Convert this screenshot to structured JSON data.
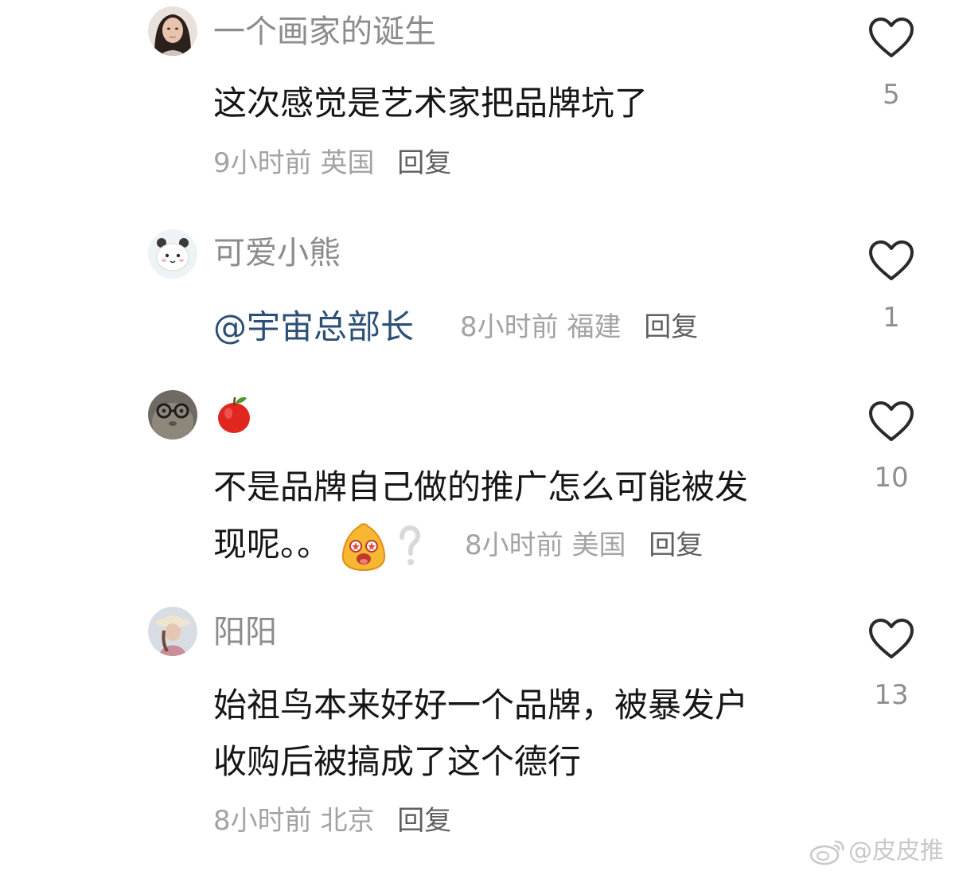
{
  "comments": [
    {
      "username": "一个画家的诞生",
      "text_lines": [
        "这次感觉是艺术家把品牌坑了"
      ],
      "time": "9小时前",
      "location": "英国",
      "reply_label": "回复",
      "likes": "5"
    },
    {
      "username": "可爱小熊",
      "mention": "@宇宙总部长",
      "time": "8小时前",
      "location": "福建",
      "reply_label": "回复",
      "likes": "1"
    },
    {
      "username": "🍎",
      "text_lines": [
        "不是品牌自己做的推广怎么可能被发",
        "现呢。。"
      ],
      "inline_icons": [
        "excited-face-emoji-icon",
        "question-mark-emoji-icon"
      ],
      "time": "8小时前",
      "location": "美国",
      "reply_label": "回复",
      "likes": "10"
    },
    {
      "username": "阳阳",
      "text_lines": [
        "始祖鸟本来好好一个品牌，被暴发户",
        "收购后被搞成了这个德行"
      ],
      "time": "8小时前",
      "location": "北京",
      "reply_label": "回复",
      "likes": "13"
    }
  ],
  "watermark": {
    "text": "@皮皮推",
    "icon": "weibo-logo-icon"
  },
  "colors": {
    "username": "#8c8c8c",
    "content": "#161616",
    "meta": "#a3a3a3",
    "reply": "#5f5f5f",
    "mention": "#2c4f77",
    "like_count": "#8f8f8f"
  }
}
